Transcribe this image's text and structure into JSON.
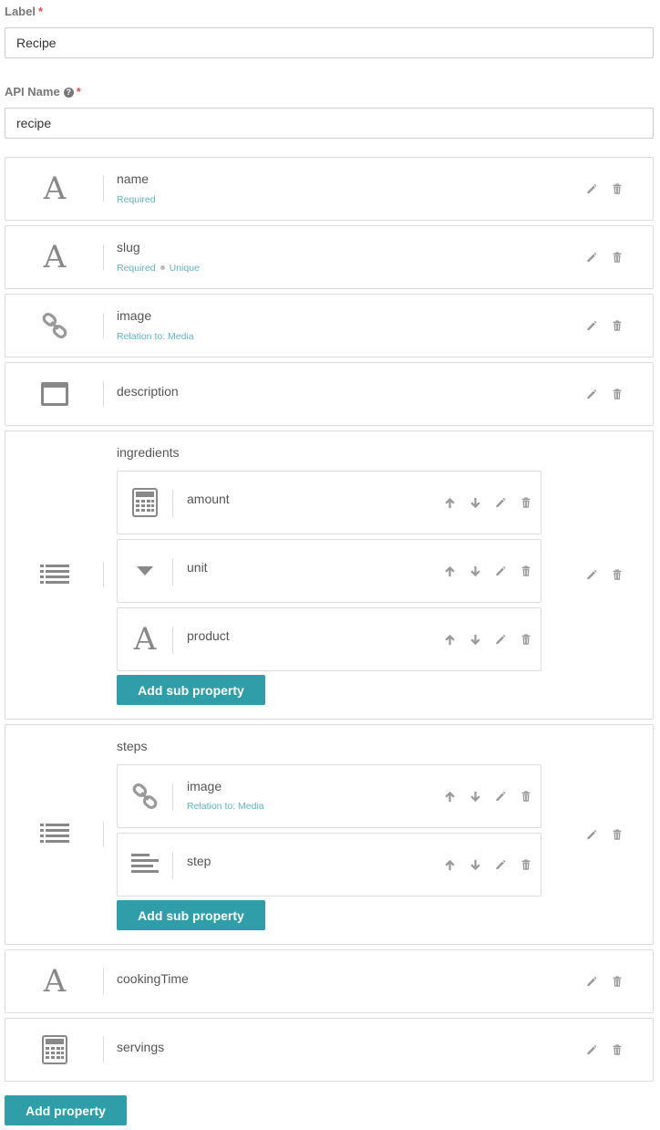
{
  "form": {
    "label_title": "Label",
    "label_value": "Recipe",
    "api_title": "API Name",
    "api_value": "recipe",
    "required_mark": "*",
    "help_glyph": "?"
  },
  "properties": [
    {
      "name": "name",
      "meta": "Required",
      "icon": "text-type-icon"
    },
    {
      "name": "slug",
      "meta": [
        "Required",
        "Unique"
      ],
      "icon": "text-type-icon"
    },
    {
      "name": "image",
      "meta": "Relation to: Media",
      "icon": "link-icon"
    },
    {
      "name": "description",
      "meta": "",
      "icon": "window-icon"
    },
    {
      "name": "ingredients",
      "icon": "list-icon",
      "sub": [
        {
          "name": "amount",
          "icon": "calculator-icon"
        },
        {
          "name": "unit",
          "icon": "dropdown-icon"
        },
        {
          "name": "product",
          "icon": "text-type-icon"
        }
      ]
    },
    {
      "name": "steps",
      "icon": "list-icon",
      "sub": [
        {
          "name": "image",
          "meta": "Relation to: Media",
          "icon": "link-icon"
        },
        {
          "name": "step",
          "icon": "paragraph-icon"
        }
      ]
    },
    {
      "name": "cookingTime",
      "meta": "",
      "icon": "text-type-icon"
    },
    {
      "name": "servings",
      "meta": "",
      "icon": "calculator-icon"
    }
  ],
  "buttons": {
    "add_sub_property": "Add sub property",
    "add_property": "Add property"
  },
  "colors": {
    "accent": "#2f9ea9",
    "meta_text": "#5fb3c2",
    "required": "#d9534f",
    "icon_gray": "#888888"
  }
}
